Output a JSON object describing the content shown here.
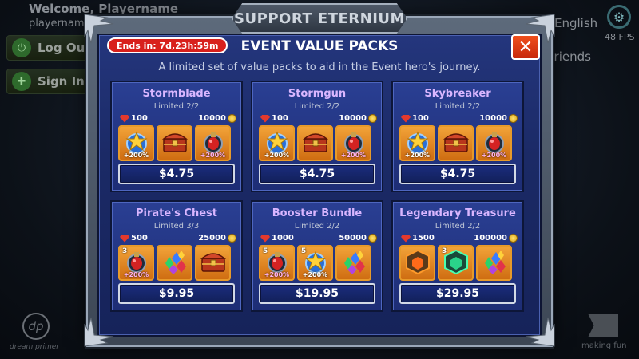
{
  "background": {
    "welcome": "Welcome, Playername",
    "username": "playername",
    "logout_label": "Log Out",
    "signin_label": "Sign In",
    "language_label": "English",
    "friends_label": "Friends",
    "fps_label": "48 FPS",
    "left_logo_text": "dream primer",
    "right_logo_text": "making fun"
  },
  "window": {
    "title": "SUPPORT ETERNIUM"
  },
  "dialog": {
    "timer": "Ends in: 7d,23h:59m",
    "title": "EVENT VALUE PACKS",
    "subtitle": "A limited set of value packs to aid in the Event hero's journey.",
    "close_label": "✕"
  },
  "packs": [
    {
      "name": "Stormblade",
      "limit": "Limited 2/2",
      "gems": "100",
      "gold": "10000",
      "price": "$4.75",
      "items": [
        {
          "icon": "xp-star-potion-icon",
          "badge": "+200%",
          "qty": ""
        },
        {
          "icon": "treasure-chest-icon",
          "badge": "",
          "qty": ""
        },
        {
          "icon": "loot-potion-icon",
          "badge": "+200%",
          "qty": ""
        }
      ]
    },
    {
      "name": "Stormgun",
      "limit": "Limited 2/2",
      "gems": "100",
      "gold": "10000",
      "price": "$4.75",
      "items": [
        {
          "icon": "xp-star-potion-icon",
          "badge": "+200%",
          "qty": ""
        },
        {
          "icon": "treasure-chest-icon",
          "badge": "",
          "qty": ""
        },
        {
          "icon": "loot-potion-icon",
          "badge": "+200%",
          "qty": ""
        }
      ]
    },
    {
      "name": "Skybreaker",
      "limit": "Limited 2/2",
      "gems": "100",
      "gold": "10000",
      "price": "$4.75",
      "items": [
        {
          "icon": "xp-star-potion-icon",
          "badge": "+200%",
          "qty": ""
        },
        {
          "icon": "treasure-chest-icon",
          "badge": "",
          "qty": ""
        },
        {
          "icon": "loot-potion-icon",
          "badge": "+200%",
          "qty": ""
        }
      ]
    },
    {
      "name": "Pirate's Chest",
      "limit": "Limited 3/3",
      "gems": "500",
      "gold": "25000",
      "price": "$9.95",
      "items": [
        {
          "icon": "loot-potion-icon",
          "badge": "+200%",
          "qty": "3"
        },
        {
          "icon": "gem-pile-icon",
          "badge": "",
          "qty": ""
        },
        {
          "icon": "treasure-chest-icon",
          "badge": "",
          "qty": ""
        }
      ]
    },
    {
      "name": "Booster Bundle",
      "limit": "Limited 2/2",
      "gems": "1000",
      "gold": "50000",
      "price": "$19.95",
      "items": [
        {
          "icon": "loot-potion-icon",
          "badge": "+200%",
          "qty": "5"
        },
        {
          "icon": "xp-star-potion-icon",
          "badge": "+200%",
          "qty": "5"
        },
        {
          "icon": "gem-pile-icon",
          "badge": "",
          "qty": ""
        }
      ]
    },
    {
      "name": "Legendary Treasure",
      "limit": "Limited 2/2",
      "gems": "1500",
      "gold": "100000",
      "price": "$29.95",
      "items": [
        {
          "icon": "orange-cube-icon",
          "badge": "",
          "qty": ""
        },
        {
          "icon": "green-cube-icon",
          "badge": "",
          "qty": "3"
        },
        {
          "icon": "gem-pile-icon",
          "badge": "",
          "qty": ""
        }
      ]
    }
  ],
  "colors": {
    "pack_name": "#d9b6ff",
    "timer_bg": "#d8201c",
    "close_bg": "#e23d16",
    "panel_bg": "#1b2a66"
  }
}
